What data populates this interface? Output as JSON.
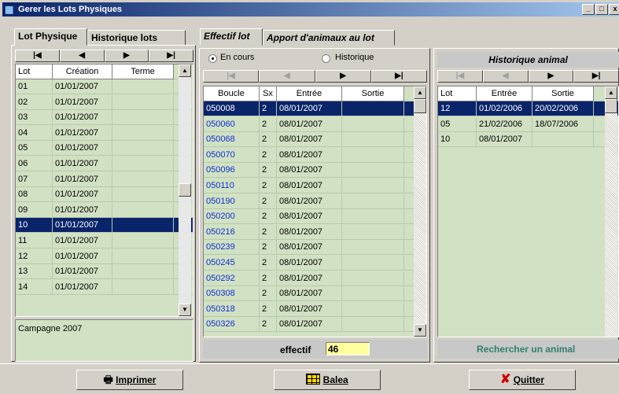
{
  "window": {
    "title": "Gerer les Lots Physiques",
    "min_label": "_",
    "max_label": "□",
    "close_label": "x"
  },
  "left_tabs": [
    {
      "label": "Lot Physique"
    },
    {
      "label": "Historique lots"
    }
  ],
  "right_tabs": [
    {
      "label": "Effectif lot"
    },
    {
      "label": "Apport d'animaux au lot"
    }
  ],
  "lot_grid": {
    "headers": [
      "Lot",
      "Création",
      "Terme"
    ],
    "rows": [
      [
        "01",
        "01/01/2007",
        ""
      ],
      [
        "02",
        "01/01/2007",
        ""
      ],
      [
        "03",
        "01/01/2007",
        ""
      ],
      [
        "04",
        "01/01/2007",
        ""
      ],
      [
        "05",
        "01/01/2007",
        ""
      ],
      [
        "06",
        "01/01/2007",
        ""
      ],
      [
        "07",
        "01/01/2007",
        ""
      ],
      [
        "08",
        "01/01/2007",
        ""
      ],
      [
        "09",
        "01/01/2007",
        ""
      ],
      [
        "10",
        "01/01/2007",
        ""
      ],
      [
        "11",
        "01/01/2007",
        ""
      ],
      [
        "12",
        "01/01/2007",
        ""
      ],
      [
        "13",
        "01/01/2007",
        ""
      ],
      [
        "14",
        "01/01/2007",
        ""
      ]
    ],
    "selected_index": 9
  },
  "campagne": "Campagne 2007",
  "radio": {
    "en_cours": "En cours",
    "historique": "Historique",
    "selected": "en_cours"
  },
  "effectif_grid": {
    "headers": [
      "Boucle",
      "Sx",
      "Entrée",
      "Sortie"
    ],
    "rows": [
      [
        "050008",
        "2",
        "08/01/2007",
        ""
      ],
      [
        "050060",
        "2",
        "08/01/2007",
        ""
      ],
      [
        "050068",
        "2",
        "08/01/2007",
        ""
      ],
      [
        "050070",
        "2",
        "08/01/2007",
        ""
      ],
      [
        "050096",
        "2",
        "08/01/2007",
        ""
      ],
      [
        "050110",
        "2",
        "08/01/2007",
        ""
      ],
      [
        "050190",
        "2",
        "08/01/2007",
        ""
      ],
      [
        "050200",
        "2",
        "08/01/2007",
        ""
      ],
      [
        "050216",
        "2",
        "08/01/2007",
        ""
      ],
      [
        "050239",
        "2",
        "08/01/2007",
        ""
      ],
      [
        "050245",
        "2",
        "08/01/2007",
        ""
      ],
      [
        "050292",
        "2",
        "08/01/2007",
        ""
      ],
      [
        "050308",
        "2",
        "08/01/2007",
        ""
      ],
      [
        "050318",
        "2",
        "08/01/2007",
        ""
      ],
      [
        "050326",
        "2",
        "08/01/2007",
        ""
      ]
    ],
    "selected_index": 0
  },
  "effectif": {
    "label": "effectif",
    "value": "46"
  },
  "historique_animal": {
    "title": "Historique animal",
    "headers": [
      "Lot",
      "Entrée",
      "Sortie"
    ],
    "rows": [
      [
        "12",
        "01/02/2006",
        "20/02/2006"
      ],
      [
        "05",
        "21/02/2006",
        "18/07/2006"
      ],
      [
        "10",
        "08/01/2007",
        ""
      ]
    ],
    "selected_index": 0
  },
  "rechercher_label": "Rechercher un animal",
  "nav_labels": {
    "first": "|◀",
    "prev": "◀",
    "next": "▶",
    "last": "▶|"
  },
  "buttons": {
    "imprimer": "Imprimer",
    "balea": "Balea",
    "quitter": "Quitter"
  },
  "colors": {
    "grid_bg": "#d1e1c4",
    "selection": "#0a246a",
    "title_bar": "#0a246a",
    "effectif_value_bg": "#ffffa0",
    "rechercher_text": "#2f8070",
    "boucle_text": "#1030d0"
  },
  "icons": [
    "app-icon",
    "printer-icon",
    "grid-icon",
    "red-x-icon"
  ]
}
